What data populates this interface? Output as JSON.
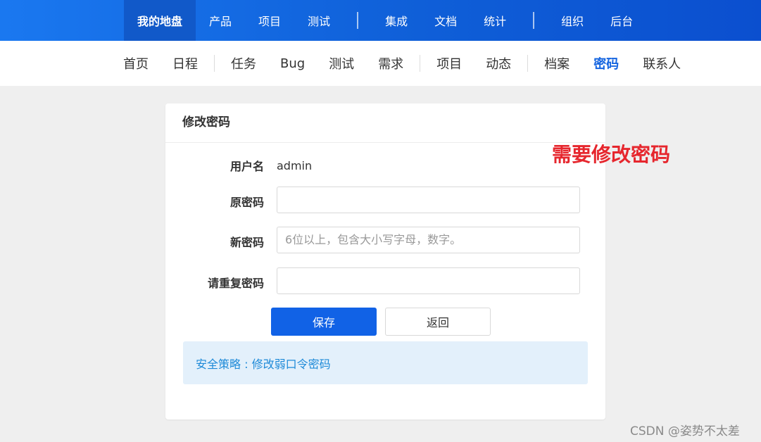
{
  "topnav": {
    "items": [
      "我的地盘",
      "产品",
      "项目",
      "测试",
      "集成",
      "文档",
      "统计",
      "组织",
      "后台"
    ]
  },
  "subnav": {
    "items": [
      "首页",
      "日程",
      "任务",
      "Bug",
      "测试",
      "需求",
      "项目",
      "动态",
      "档案",
      "密码",
      "联系人"
    ]
  },
  "panel": {
    "title": "修改密码",
    "fields": {
      "username_label": "用户名",
      "username_value": "admin",
      "old_password_label": "原密码",
      "new_password_label": "新密码",
      "new_password_placeholder": "6位以上，包含大小写字母，数字。",
      "repeat_password_label": "请重复密码"
    },
    "buttons": {
      "save": "保存",
      "back": "返回"
    },
    "policy": "安全策略 : 修改弱口令密码"
  },
  "annotation": "需要修改密码",
  "watermark": "CSDN @姿势不太差",
  "colors": {
    "primary": "#1162e6",
    "annotation": "#e6262d",
    "policy_bg": "#e3f0fb"
  }
}
